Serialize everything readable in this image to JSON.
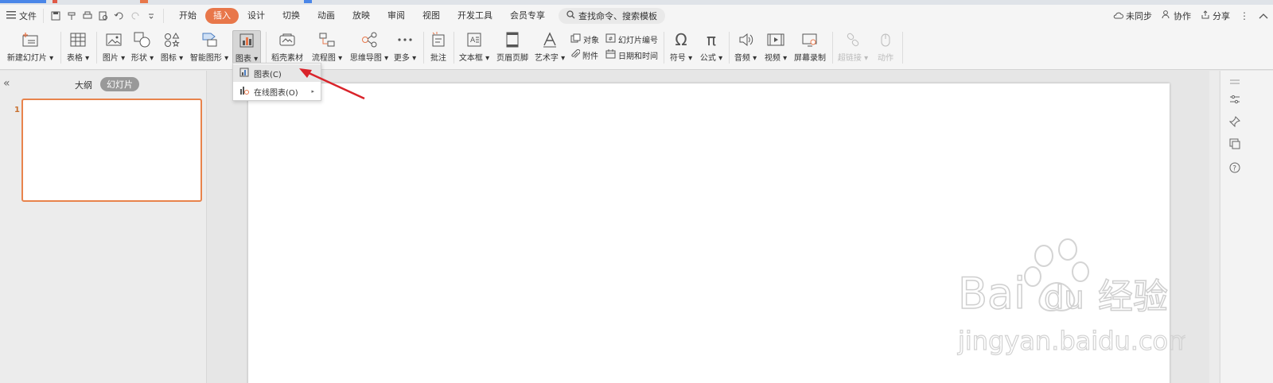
{
  "menubar": {
    "file_label": "文件",
    "tabs": [
      "开始",
      "插入",
      "设计",
      "切换",
      "动画",
      "放映",
      "审阅",
      "视图",
      "开发工具",
      "会员专享"
    ],
    "active_tab": "插入",
    "search_placeholder": "查找命令、搜索模板",
    "sync_label": "未同步",
    "collab_label": "协作",
    "share_label": "分享"
  },
  "ribbon": {
    "new_slide": "新建幻灯片",
    "table": "表格",
    "picture": "图片",
    "shape": "形状",
    "icon": "图标",
    "smartart": "智能图形",
    "chart": "图表",
    "material": "稻壳素材",
    "flowchart": "流程图",
    "mindmap": "思维导图",
    "more": "更多",
    "comment": "批注",
    "textbox": "文本框",
    "header_footer": "页眉页脚",
    "wordart": "艺术字",
    "object": "对象",
    "attachment": "附件",
    "slide_number": "幻灯片编号",
    "datetime": "日期和时间",
    "symbol": "符号",
    "formula": "公式",
    "audio": "音频",
    "video": "视频",
    "screen_record": "屏幕录制",
    "hyperlink": "超链接",
    "action": "动作"
  },
  "chart_menu": {
    "item1": "图表(C)",
    "item2": "在线图表(O)"
  },
  "left_panel": {
    "outline_tab": "大纲",
    "slides_tab": "幻灯片",
    "slide_number": "1"
  },
  "watermark": {
    "brand": "Bai",
    "brand2": "du",
    "suffix": "经验",
    "url": "jingyan.baidu.com"
  },
  "colors": {
    "accent": "#e8774a",
    "arrow": "#d9232a",
    "thumb_border": "#e8834c"
  }
}
